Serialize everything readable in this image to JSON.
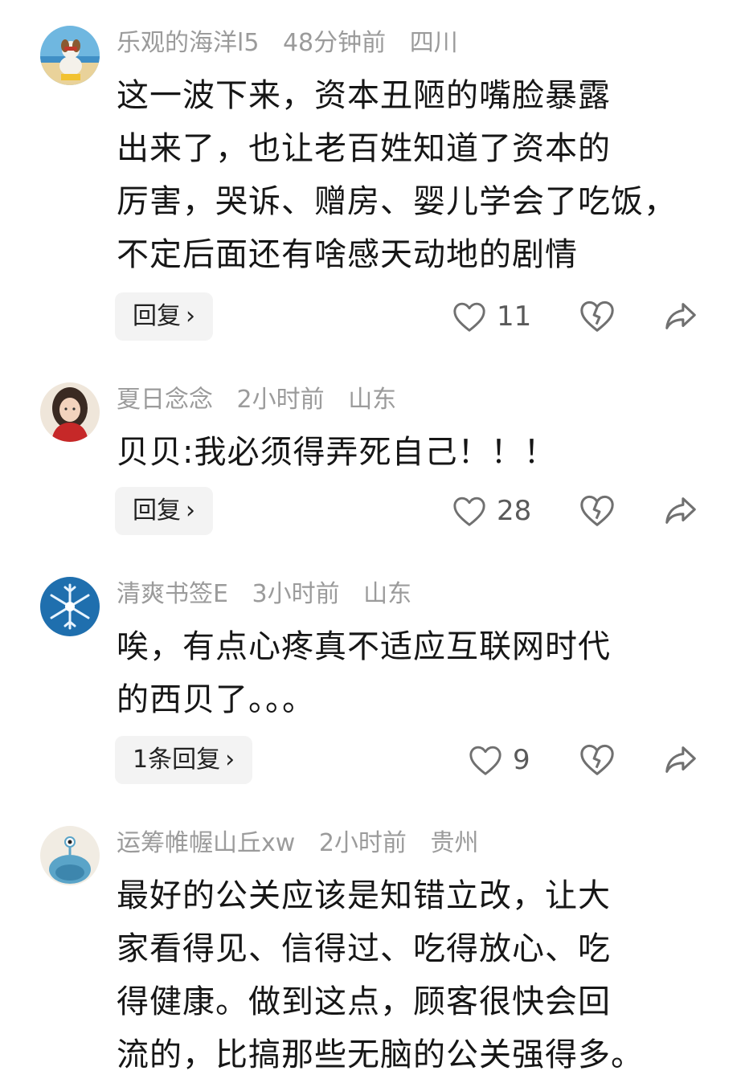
{
  "comments": [
    {
      "username": "乐观的海洋l5",
      "time": "48分钟前",
      "location": "四川",
      "lines": [
        "这一波下来，资本丑陋的嘴脸暴露",
        "出来了，也让老百姓知道了资本的",
        "厉害，哭诉、赠房、婴儿学会了吃饭，",
        "不定后面还有啥感天动地的剧情"
      ],
      "reply_label": "回复",
      "likes": "11",
      "avatar": "dog-on-beach"
    },
    {
      "username": "夏日念念",
      "time": "2小时前",
      "location": "山东",
      "lines": [
        "贝贝:我必须得弄死自己！！！"
      ],
      "reply_label": "回复",
      "likes": "28",
      "avatar": "girl-red-scarf"
    },
    {
      "username": "清爽书签E",
      "time": "3小时前",
      "location": "山东",
      "lines": [
        "唉，有点心疼真不适应互联网时代",
        "的西贝了。。。"
      ],
      "reply_label": "1条回复",
      "likes": "9",
      "avatar": "snowflake"
    },
    {
      "username": "运筹帷幄山丘xw",
      "time": "2小时前",
      "location": "贵州",
      "lines": [
        "最好的公关应该是知错立改，让大",
        "家看得见、信得过、吃得放心、吃",
        "得健康。做到这点，顾客很快会回",
        "流的，比搞那些无脑的公关强得多。"
      ],
      "avatar": "blue-cartoon-creature"
    }
  ],
  "icons": {
    "reply_chevron": "›",
    "like": "heart-outline-icon",
    "dislike": "broken-heart-icon",
    "share": "share-arrow-icon"
  },
  "colors": {
    "text": "#161616",
    "meta": "#9b9b9b",
    "button_bg": "#f3f3f3",
    "icon": "#707070"
  }
}
